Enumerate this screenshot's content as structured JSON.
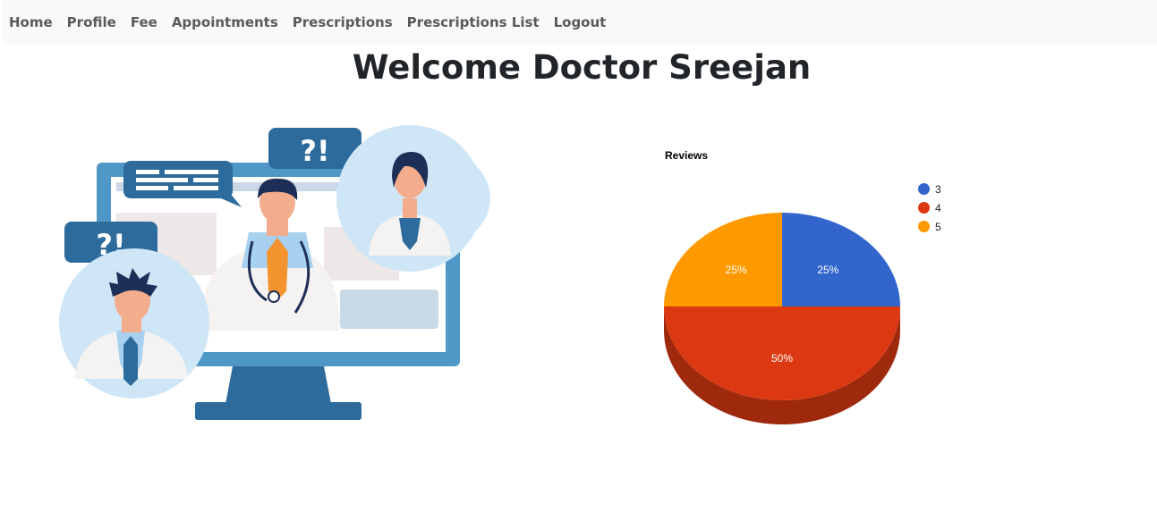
{
  "nav": {
    "items": [
      "Home",
      "Profile",
      "Fee",
      "Appointments",
      "Prescriptions",
      "Prescriptions List",
      "Logout"
    ]
  },
  "page": {
    "title": "Welcome Doctor Sreejan"
  },
  "illustration": {
    "bubble_left": "?!",
    "bubble_top": "?!"
  },
  "chart_data": {
    "type": "pie",
    "title": "Reviews",
    "three_d": true,
    "legend_position": "right",
    "slices": [
      {
        "label": "3",
        "value": 25,
        "percent_label": "25%",
        "color": "#3366cc"
      },
      {
        "label": "4",
        "value": 50,
        "percent_label": "50%",
        "color": "#dc3912"
      },
      {
        "label": "5",
        "value": 25,
        "percent_label": "25%",
        "color": "#ff9900"
      }
    ]
  }
}
